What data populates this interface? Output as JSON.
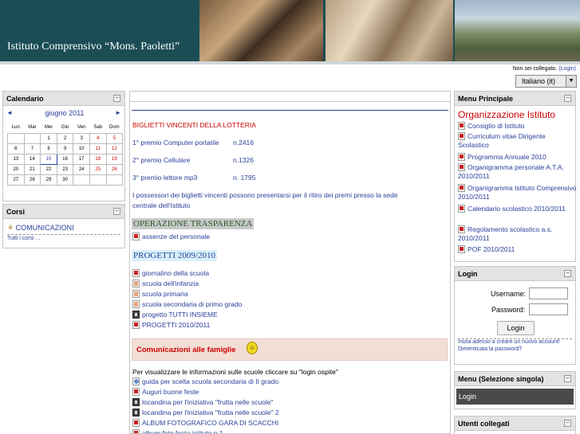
{
  "header": {
    "title": "Istituto Comprensivo “Mons. Paoletti”",
    "login_status": "Non sei collegato.",
    "login_link": "(Login)",
    "language": "Italiano (it)"
  },
  "calendar": {
    "title": "Calendario",
    "month": "giugno 2011",
    "prev": "◄",
    "next": "►",
    "weekdays": [
      "Lun",
      "Mar",
      "Mer",
      "Gio",
      "Ven",
      "Sab",
      "Dom"
    ],
    "weeks": [
      [
        "",
        "",
        "1",
        "2",
        "3",
        "4",
        "5"
      ],
      [
        "6",
        "7",
        "8",
        "9",
        "10",
        "11",
        "12"
      ],
      [
        "13",
        "14",
        "15",
        "16",
        "17",
        "18",
        "19"
      ],
      [
        "20",
        "21",
        "22",
        "23",
        "24",
        "25",
        "26"
      ],
      [
        "27",
        "28",
        "29",
        "30",
        "",
        "",
        ""
      ]
    ],
    "today": "15"
  },
  "courses": {
    "title": "Corsi",
    "item": "COMUNICAZIONI",
    "all": "Tutti i corsi ..."
  },
  "main": {
    "lottery_title": "BIGLIETTI VINCENTI DELLA LOTTERIA",
    "prizes": [
      {
        "label": "1° premio Computer portatile",
        "number": "n.2416"
      },
      {
        "label": "2° premio Cellulare",
        "number": "n.1326"
      },
      {
        "label": "3° premio lettore mp3",
        "number": "n. 1795"
      }
    ],
    "notice_line1": "I possessori dei biglietti vincenti possono presentarsi per il ritiro dei premi presso la sede",
    "notice_line2": "centrale dell'Istituto",
    "trasparenza_title": "OPERAZIONE TRASPARENZA",
    "trasparenza_link": "assenze del personale",
    "progetti_title": "PROGETTI 2009/2010",
    "progetti_links": [
      {
        "icon": "pdf",
        "label": "giornalino della scuola"
      },
      {
        "icon": "doc",
        "label": "scuola dell'infanzia"
      },
      {
        "icon": "doc",
        "label": "scuola primaria"
      },
      {
        "icon": "doc",
        "label": "scuola secondaria di primo grado"
      },
      {
        "icon": "film",
        "label": "progetto TUTTI INSIEME"
      },
      {
        "icon": "pdf",
        "label": "PROGETTI 2010/2011"
      }
    ],
    "comunicazioni_title": "Comunicazioni alle famiglie",
    "ospite_note": "Per visualizzare le informazioni sulle scuole cliccare su \"login ospite\"",
    "comunicazioni_links": [
      {
        "icon": "web",
        "label": "guida per scelta scuola secondaria di II grado"
      },
      {
        "icon": "pdf",
        "label": "Auguri buone feste"
      },
      {
        "icon": "film",
        "label": "locandina per l'iniziativa \"frutta nelle scuole\""
      },
      {
        "icon": "film",
        "label": "locandina per l'iniziativa \"frutta nelle scuole\" 2"
      },
      {
        "icon": "pdf",
        "label": "ALBUM FOTOGRAFICO GARA DI SCACCHI"
      },
      {
        "icon": "pdf",
        "label": "album foto festa istituto n.1"
      }
    ]
  },
  "menu_principale": {
    "title": "Menu Principale",
    "heading": "Organizzazione Istituto",
    "items": [
      "Consiglio di Istituto",
      "Curriculum vitae Dirigente Scolastico",
      "Programma Annuale 2010",
      "Organigramma personale A.T.A. 2010/2011",
      "Organigramma Istituto Comprensivo 2010/2011",
      "Calendario scolastico 2010/2011",
      "Regolamento scolastico a.s. 2010/2011",
      "POF 2010/2011"
    ]
  },
  "login": {
    "title": "Login",
    "username_label": "Username:",
    "password_label": "Password:",
    "button": "Login",
    "create_account": "Inizia adesso a creare un nuovo account!",
    "forgot": "Dimenticata la password?"
  },
  "menu_sel": {
    "title": "Menu (Selezione singola)",
    "item": "Login"
  },
  "online": {
    "title": "Utenti collegati"
  }
}
